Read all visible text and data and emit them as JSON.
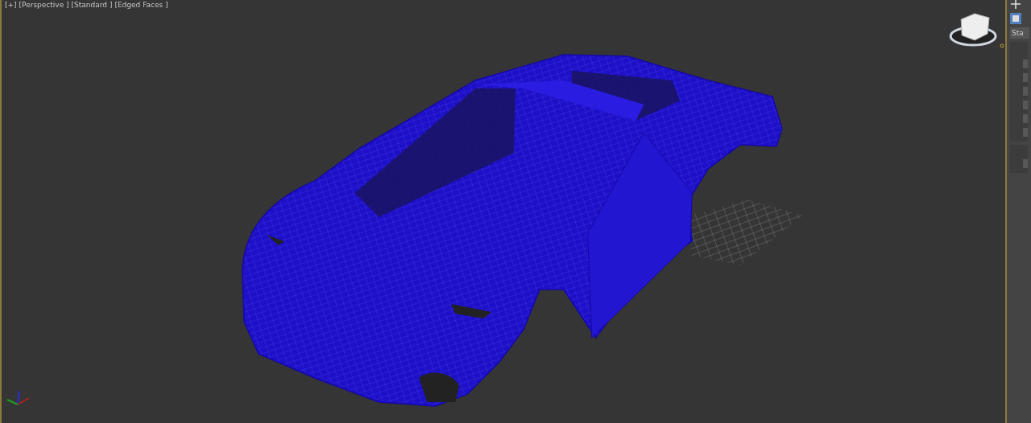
{
  "viewport": {
    "labels": [
      "[+]",
      "[Perspective ]",
      "[Standard ]",
      "[Edged Faces ]"
    ]
  },
  "command_panel": {
    "dropdown": "Sta"
  }
}
